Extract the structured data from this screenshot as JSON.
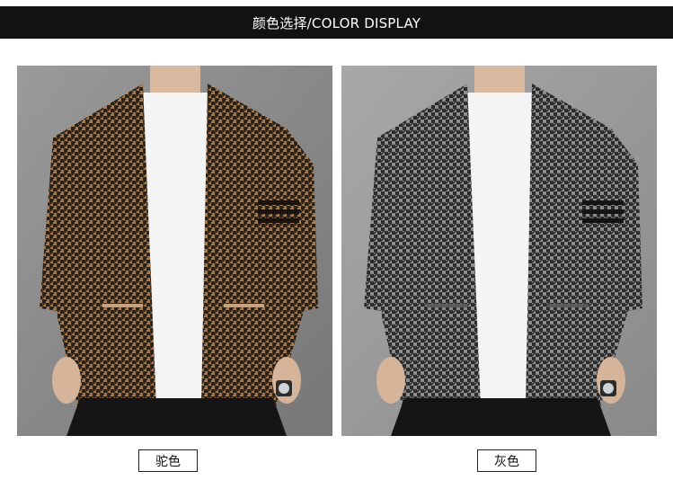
{
  "header": {
    "title": "颜色选择/COLOR DISPLAY"
  },
  "products": [
    {
      "caption": "驼色",
      "knit_color": "#a57c52",
      "pattern_dark": "#2a211a",
      "photo_bg": "#8a8a8a"
    },
    {
      "caption": "灰色",
      "knit_color": "#8c8c8c",
      "pattern_dark": "#2b2b2b",
      "photo_bg": "#9c9c9c"
    }
  ],
  "colors": {
    "header_bar": "#121212",
    "page_bg": "#ffffff"
  }
}
